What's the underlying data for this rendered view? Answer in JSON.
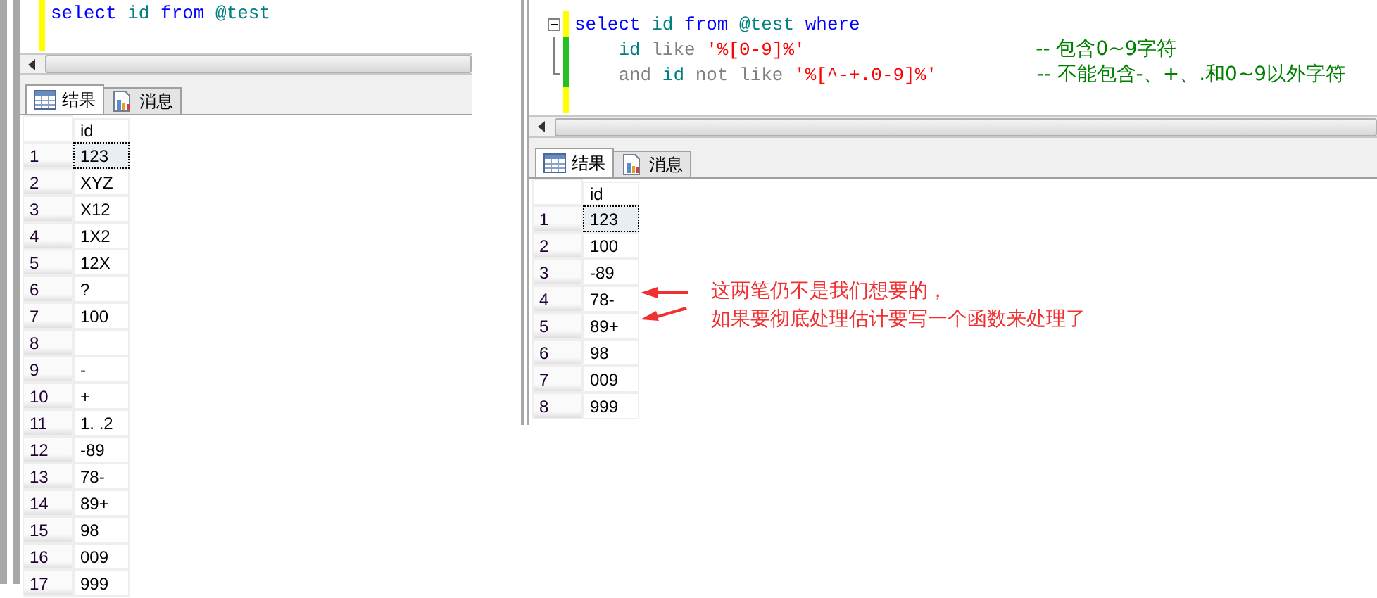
{
  "panels": [
    {
      "editor": {
        "lines": [
          {
            "saved": false,
            "tokens": [
              {
                "kind": "keyword",
                "text": "select"
              },
              {
                "kind": "ident",
                "text": "id"
              },
              {
                "kind": "keyword",
                "text": "from"
              },
              {
                "kind": "ident",
                "text": "@test"
              }
            ]
          }
        ]
      },
      "tabs": [
        {
          "label": "结果",
          "kind": "results",
          "selected": true
        },
        {
          "label": "消息",
          "kind": "messages",
          "selected": false
        }
      ],
      "grid": {
        "columns": [
          "id"
        ],
        "rows": [
          {
            "num": "1",
            "cells": [
              "123"
            ],
            "selected": true
          },
          {
            "num": "2",
            "cells": [
              "XYZ"
            ],
            "selected": false
          },
          {
            "num": "3",
            "cells": [
              "X12"
            ],
            "selected": false
          },
          {
            "num": "4",
            "cells": [
              "1X2"
            ],
            "selected": false
          },
          {
            "num": "5",
            "cells": [
              "12X"
            ],
            "selected": false
          },
          {
            "num": "6",
            "cells": [
              "?"
            ],
            "selected": false
          },
          {
            "num": "7",
            "cells": [
              "100"
            ],
            "selected": false
          },
          {
            "num": "8",
            "cells": [],
            "selected": false
          },
          {
            "num": "9",
            "cells": [
              "-"
            ],
            "selected": false
          },
          {
            "num": "10",
            "cells": [
              "+"
            ],
            "selected": false
          },
          {
            "num": "11",
            "cells": [
              "1. .2"
            ],
            "selected": false
          },
          {
            "num": "12",
            "cells": [
              "-89"
            ],
            "selected": false
          },
          {
            "num": "13",
            "cells": [
              "78-"
            ],
            "selected": false
          },
          {
            "num": "14",
            "cells": [
              "89+"
            ],
            "selected": false
          },
          {
            "num": "15",
            "cells": [
              "98"
            ],
            "selected": false
          },
          {
            "num": "16",
            "cells": [
              "009"
            ],
            "selected": false
          },
          {
            "num": "17",
            "cells": [
              "999"
            ],
            "selected": false
          }
        ]
      }
    },
    {
      "editor": {
        "lines": [
          {
            "saved": false,
            "collapsible": true,
            "tokens": [
              {
                "kind": "keyword",
                "text": "select"
              },
              {
                "kind": "ident",
                "text": "id"
              },
              {
                "kind": "keyword",
                "text": "from"
              },
              {
                "kind": "ident",
                "text": "@test"
              },
              {
                "kind": "keyword",
                "text": "where"
              }
            ]
          },
          {
            "saved": true,
            "collapsible": false,
            "indent": true,
            "tokens": [
              {
                "kind": "ident",
                "text": "id"
              },
              {
                "kind": "op",
                "text": "like"
              },
              {
                "kind": "string",
                "text": "'%[0-9]%'"
              },
              {
                "kind": "comment",
                "text": "-- 包含0~9字符"
              }
            ]
          },
          {
            "saved": true,
            "collapsible": false,
            "indent": true,
            "tokens": [
              {
                "kind": "op",
                "text": "and"
              },
              {
                "kind": "ident",
                "text": "id"
              },
              {
                "kind": "op",
                "text": "not"
              },
              {
                "kind": "op",
                "text": "like"
              },
              {
                "kind": "string",
                "text": "'%[^-+.0-9]%'"
              },
              {
                "kind": "comment",
                "text": "-- 不能包含-、+、.和0~9以外字符"
              }
            ]
          }
        ]
      },
      "tabs": [
        {
          "label": "结果",
          "kind": "results",
          "selected": true
        },
        {
          "label": "消息",
          "kind": "messages",
          "selected": false
        }
      ],
      "grid": {
        "columns": [
          "id"
        ],
        "rows": [
          {
            "num": "1",
            "cells": [
              "123"
            ],
            "selected": true
          },
          {
            "num": "2",
            "cells": [
              "100"
            ],
            "selected": false
          },
          {
            "num": "3",
            "cells": [
              "-89"
            ],
            "selected": false
          },
          {
            "num": "4",
            "cells": [
              "78-"
            ],
            "selected": false
          },
          {
            "num": "5",
            "cells": [
              "89+"
            ],
            "selected": false
          },
          {
            "num": "6",
            "cells": [
              "98"
            ],
            "selected": false
          },
          {
            "num": "7",
            "cells": [
              "009"
            ],
            "selected": false
          },
          {
            "num": "8",
            "cells": [
              "999"
            ],
            "selected": false
          }
        ]
      }
    }
  ],
  "annotation": {
    "lines": [
      "这两笔仍不是我们想要的，",
      "如果要彻底处理估计要写一个函数来处理了"
    ]
  }
}
